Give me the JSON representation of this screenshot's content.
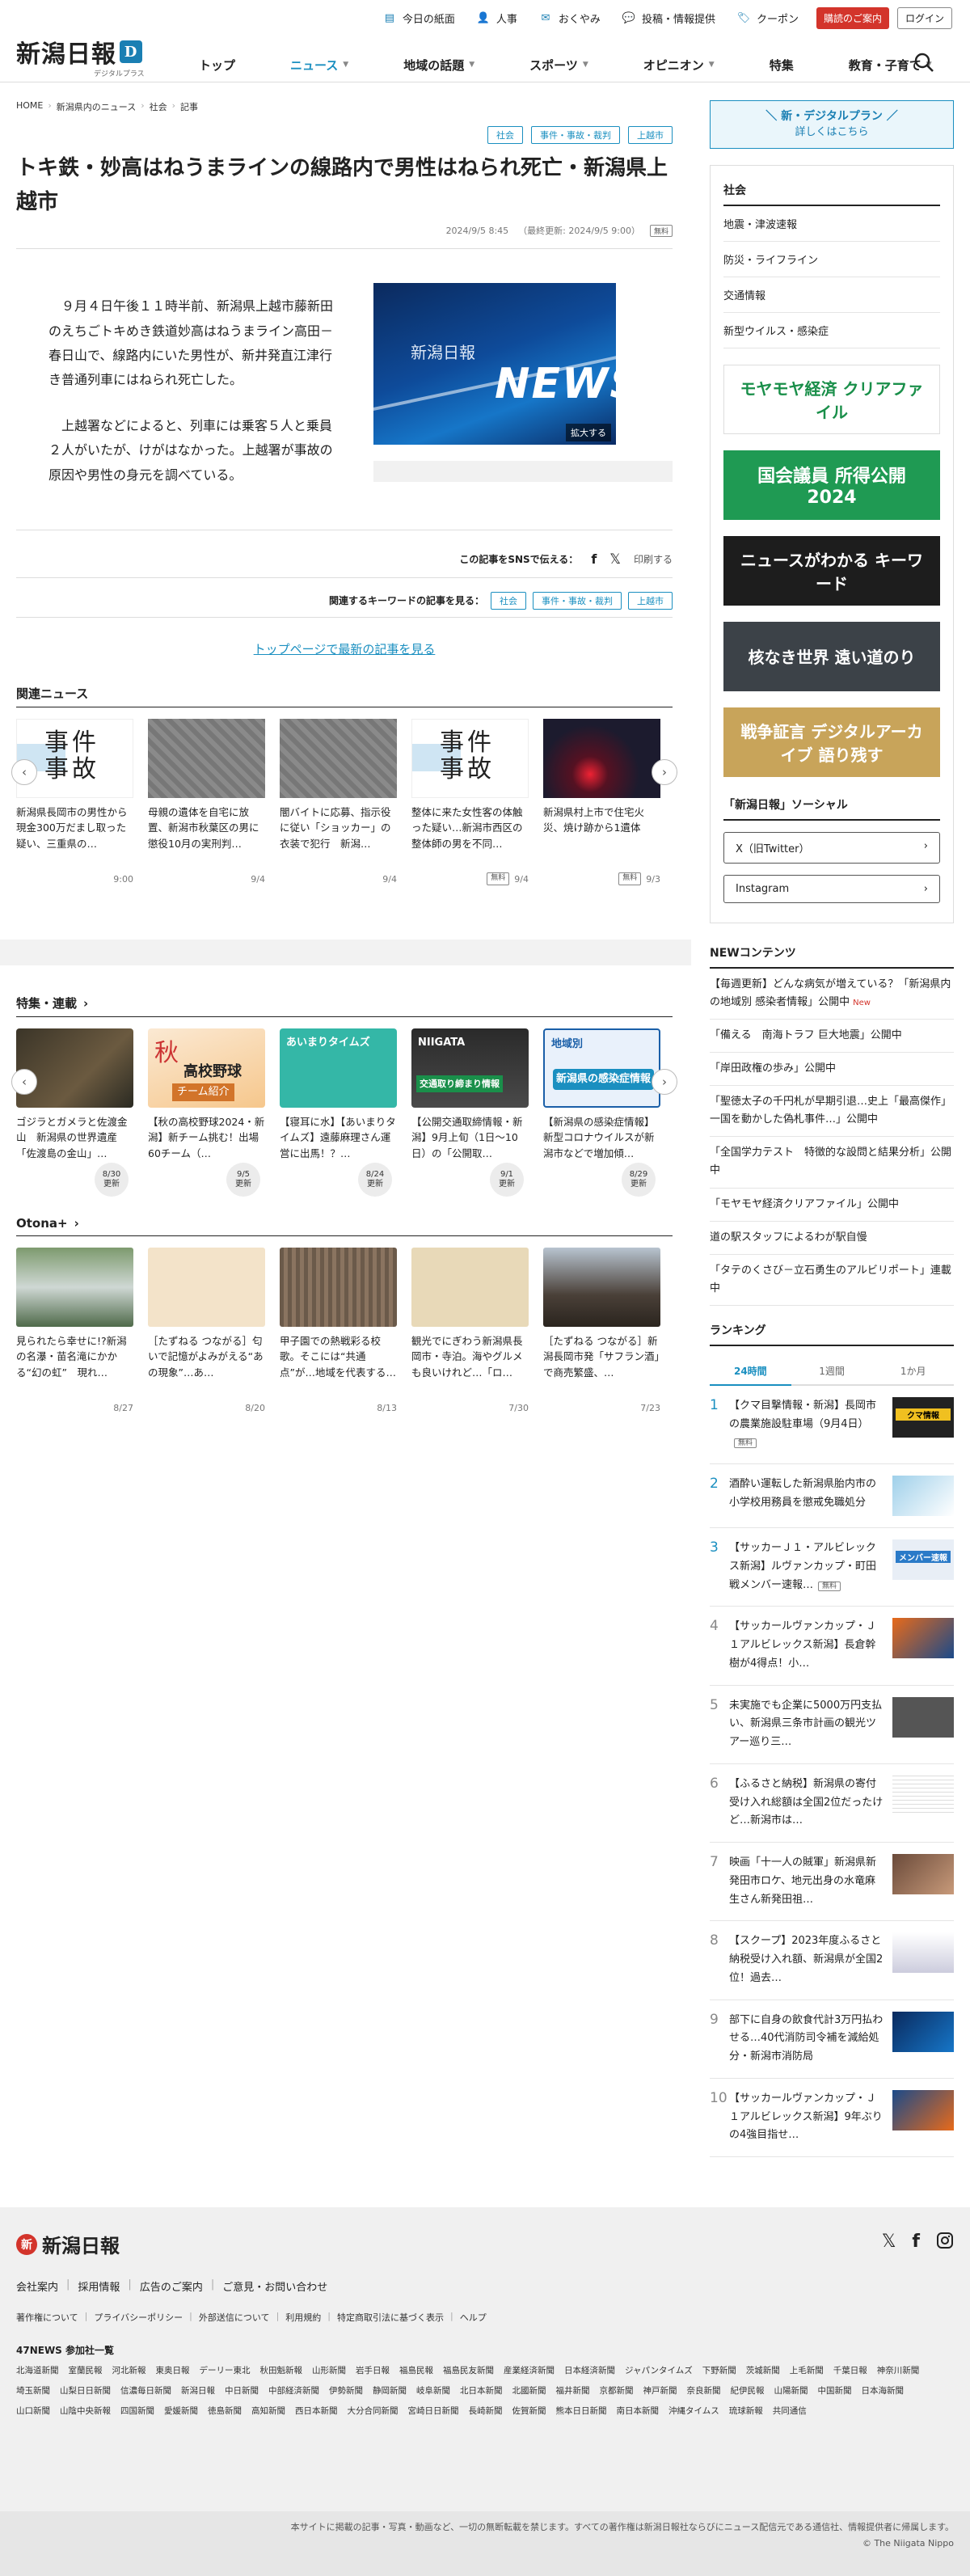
{
  "header": {
    "top_links": [
      {
        "icon": "newspaper-icon",
        "label": "今日の紙面"
      },
      {
        "icon": "person-icon",
        "label": "人事"
      },
      {
        "icon": "condolence-icon",
        "label": "おくやみ"
      },
      {
        "icon": "speech-icon",
        "label": "投稿・情報提供"
      },
      {
        "icon": "coupon-icon",
        "label": "クーポン"
      }
    ],
    "subscribe": "購読のご案内",
    "login": "ログイン",
    "logo": "新潟日報",
    "logo_sub": "デジタルプラス",
    "nav": [
      "トップ",
      "ニュース",
      "地域の話題",
      "スポーツ",
      "オピニオン",
      "特集",
      "教育・子育て"
    ]
  },
  "breadcrumb": [
    "HOME",
    "新潟県内のニュース",
    "社会",
    "記事"
  ],
  "article": {
    "tags": [
      "社会",
      "事件・事故・裁判",
      "上越市"
    ],
    "title": "トキ鉄・妙高はねうまラインの線路内で男性はねられ死亡・新潟県上越市",
    "date": "2024/9/5 8:45",
    "updated": "（最終更新: 2024/9/5 9:00）",
    "free": "無料",
    "p1": "９月４日午後１１時半前、新潟県上越市藤新田のえちごトキめき鉄道妙高はねうまライン高田－春日山で、線路内にいた男性が、新井発直江津行き普通列車にはねられ死亡した。",
    "p2": "上越署などによると、列車には乗客５人と乗員２人がいたが、けがはなかった。上越署が事故の原因や男性の身元を調べている。",
    "photo_logo": "新潟日報",
    "photo_word": "NEWS",
    "zoom": "拡大する",
    "share_label": "この記事をSNSで伝える：",
    "print": "印刷する",
    "kw_label": "関連するキーワードの記事を見る：",
    "toplink": "トップページで最新の記事を見る"
  },
  "related": {
    "head": "関連ニュース",
    "items": [
      {
        "title": "新潟県長岡市の男性から現金300万だまし取った疑い、三重県の…",
        "date": "9:00",
        "free": ""
      },
      {
        "title": "母親の遺体を自宅に放置、新潟市秋葉区の男に懲役10月の実刑判…",
        "date": "9/4",
        "free": ""
      },
      {
        "title": "闇バイトに応募、指示役に従い「ショッカー」の衣装で犯行　新潟…",
        "date": "9/4",
        "free": ""
      },
      {
        "title": "整体に来た女性客の体触った疑い…新潟市西区の整体師の男を不同…",
        "date": "9/4",
        "free": "無料"
      },
      {
        "title": "新潟県村上市で住宅火災、焼け跡から1遺体",
        "date": "9/3",
        "free": "無料"
      }
    ],
    "thumb_text": "事件事故"
  },
  "features": {
    "head": "特集・連載",
    "items": [
      {
        "title": "ゴジラとガメラと佐渡金山　新潟県の世界遺産「佐渡島の金山」…",
        "badge_date": "8/30",
        "badge": "更新"
      },
      {
        "title": "【秋の高校野球2024・新潟】新チーム挑む！出場60チーム（…",
        "badge_date": "9/5",
        "badge": "更新",
        "img_a": "秋",
        "img_b": "高校野球",
        "img_c": "チーム紹介"
      },
      {
        "title": "【寝耳に水】【あいまりタイムズ】遠藤麻理さん運営に出馬！？…",
        "badge_date": "8/24",
        "badge": "更新",
        "img_a": "あいまりタイムズ"
      },
      {
        "title": "【公開交通取締情報・新潟】9月上旬（1日〜10日）の「公開取…",
        "badge_date": "9/1",
        "badge": "更新",
        "img_a": "NIIGATA",
        "img_b": "交通取り締まり情報"
      },
      {
        "title": "【新潟県の感染症情報】新型コロナウイルスが新潟市などで増加傾…",
        "badge_date": "8/29",
        "badge": "更新",
        "img_a": "地域別",
        "img_b": "新潟県の感染症情報"
      }
    ]
  },
  "otona": {
    "head": "Otona+",
    "items": [
      {
        "title": "見られたら幸せに!?新潟の名瀑・苗名滝にかかる“幻の虹”　現れ…",
        "date": "8/27"
      },
      {
        "title": "［たずねる つながる］匂いで記憶がよみがえる“あの現象”…あ…",
        "date": "8/20"
      },
      {
        "title": "甲子園での熱戦彩る校歌。そこには“共通点”が…地域を代表する…",
        "date": "8/13"
      },
      {
        "title": "観光でにぎわう新潟県長岡市・寺泊。海やグルメも良いけれど…「ロ…",
        "date": "7/30"
      },
      {
        "title": "［たずねる つながる］新潟長岡市発「サフラン酒」で商売繁盛、…",
        "date": "7/23"
      }
    ]
  },
  "sidebar": {
    "plan_title": "＼ 新・デジタルプラン ／",
    "plan_sub": "詳しくはこちら",
    "cat_head": "社会",
    "cat_links": [
      "地震・津波速報",
      "防災・ライフライン",
      "交通情報",
      "新型ウイルス・感染症"
    ],
    "banners": [
      {
        "text": "モヤモヤ経済 クリアファイル"
      },
      {
        "text": "国会議員 所得公開 2024"
      },
      {
        "text": "ニュースがわかる キーワード"
      },
      {
        "text": "核なき世界 遠い道のり"
      },
      {
        "text": "戦争証言 デジタルアーカイブ 語り残す"
      }
    ],
    "social_head": "「新潟日報」ソーシャル",
    "social": [
      "X（旧Twitter）",
      "Instagram"
    ],
    "new_head": "NEWコンテンツ",
    "new_items": [
      {
        "text": "【毎週更新】どんな病気が増えている？「新潟県内の地域別 感染者情報」公開中",
        "new": "New"
      },
      {
        "text": "「備える　南海トラフ 巨大地震」公開中",
        "new": ""
      },
      {
        "text": "「岸田政権の歩み」公開中",
        "new": ""
      },
      {
        "text": "「聖徳太子の千円札が早期引退…史上「最高傑作」一国を動かした偽札事件…」公開中",
        "new": ""
      },
      {
        "text": "「全国学力テスト　特徴的な設問と結果分析」公開中",
        "new": ""
      },
      {
        "text": "「モヤモヤ経済クリアファイル」公開中",
        "new": ""
      },
      {
        "text": "道の駅スタッフによるわが駅自慢",
        "new": ""
      },
      {
        "text": "「タテのくさび－立石勇生のアルビリポート」連載中",
        "new": ""
      }
    ],
    "rank_head": "ランキング",
    "rank_tabs": [
      "24時間",
      "1週間",
      "1か月"
    ],
    "ranking": [
      {
        "n": "1",
        "title": "【クマ目撃情報・新潟】長岡市の農業施設駐車場（9月4日）",
        "free": "無料",
        "img": "クマ情報"
      },
      {
        "n": "2",
        "title": "酒酔い運転した新潟県胎内市の小学校用務員を懲戒免職処分",
        "free": "",
        "img": ""
      },
      {
        "n": "3",
        "title": "【サッカーＪ１・アルビレックス新潟】ルヴァンカップ・町田戦メンバー速報…",
        "free": "無料",
        "img": "メンバー速報"
      },
      {
        "n": "4",
        "title": "【サッカールヴァンカップ・Ｊ１アルビレックス新潟】長倉幹樹が4得点！小…",
        "free": "",
        "img": ""
      },
      {
        "n": "5",
        "title": "未実施でも企業に5000万円支払い、新潟県三条市計画の観光ツアー巡り三…",
        "free": "",
        "img": ""
      },
      {
        "n": "6",
        "title": "【ふるさと納税】新潟県の寄付受け入れ総額は全国2位だったけど…新潟市は…",
        "free": "",
        "img": ""
      },
      {
        "n": "7",
        "title": "映画「十一人の賊軍」新潟県新発田市ロケ、地元出身の水竜麻生さん新発田祖…",
        "free": "",
        "img": ""
      },
      {
        "n": "8",
        "title": "【スクープ】2023年度ふるさと納税受け入れ額、新潟県が全国2位！過去…",
        "free": "",
        "img": ""
      },
      {
        "n": "9",
        "title": "部下に自身の飲食代計3万円払わせる…40代消防司令補を減給処分・新潟市消防局",
        "free": "",
        "img": ""
      },
      {
        "n": "10",
        "title": "【サッカールヴァンカップ・Ｊ１アルビレックス新潟】9年ぶりの4強目指せ…",
        "free": "",
        "img": ""
      }
    ]
  },
  "footer": {
    "logo": "新潟日報",
    "links": [
      "会社案内",
      "採用情報",
      "広告のご案内",
      "ご意見・お問い合わせ"
    ],
    "links2": [
      "著作権について",
      "プライバシーポリシー",
      "外部送信について",
      "利用規約",
      "特定商取引法に基づく表示",
      "ヘルプ"
    ],
    "p47": "47NEWS 参加社一覧",
    "papers": [
      "北海道新聞",
      "室蘭民報",
      "河北新報",
      "東奥日報",
      "デーリー東北",
      "秋田魁新報",
      "山形新聞",
      "岩手日報",
      "福島民報",
      "福島民友新聞",
      "産業経済新聞",
      "日本経済新聞",
      "ジャパンタイムズ",
      "下野新聞",
      "茨城新聞",
      "上毛新聞",
      "千葉日報",
      "神奈川新聞",
      "埼玉新聞",
      "山梨日日新聞",
      "信濃毎日新聞",
      "新潟日報",
      "中日新聞",
      "中部経済新聞",
      "伊勢新聞",
      "静岡新聞",
      "岐阜新聞",
      "北日本新聞",
      "北國新聞",
      "福井新聞",
      "京都新聞",
      "神戸新聞",
      "奈良新聞",
      "紀伊民報",
      "山陽新聞",
      "中国新聞",
      "日本海新聞",
      "山口新聞",
      "山陰中央新報",
      "四国新聞",
      "愛媛新聞",
      "徳島新聞",
      "高知新聞",
      "西日本新聞",
      "大分合同新聞",
      "宮崎日日新聞",
      "長崎新聞",
      "佐賀新聞",
      "熊本日日新聞",
      "南日本新聞",
      "沖縄タイムス",
      "琉球新報",
      "共同通信"
    ],
    "copy": "本サイトに掲載の記事・写真・動画など、一切の無断転載を禁じます。すべての著作権は新潟日報社ならびにニュース配信元である通信社、情報提供者に帰属します。",
    "copy2": "© The Niigata Nippo"
  }
}
